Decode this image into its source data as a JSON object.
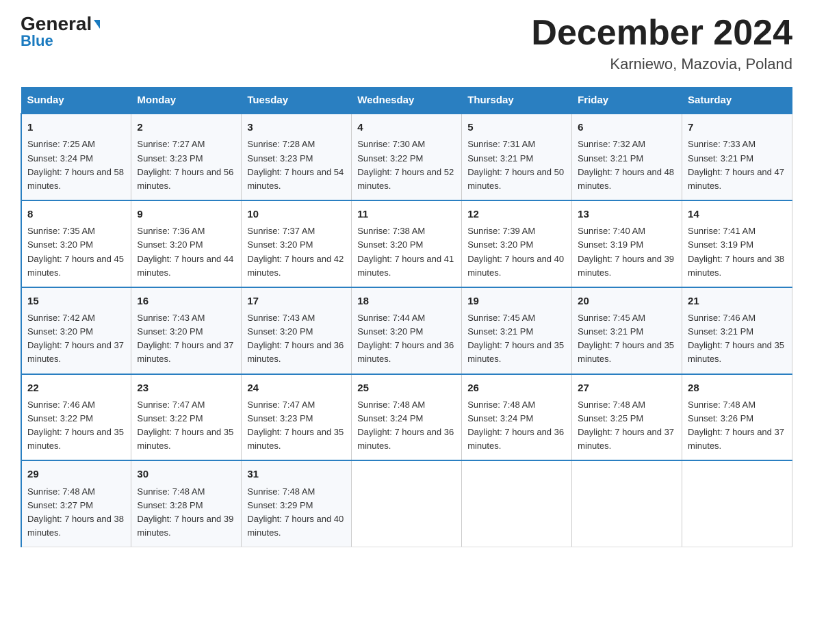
{
  "header": {
    "logo_main": "General",
    "logo_arrow": "▶",
    "logo_sub": "Blue",
    "month_title": "December 2024",
    "location": "Karniewo, Mazovia, Poland"
  },
  "weekdays": [
    "Sunday",
    "Monday",
    "Tuesday",
    "Wednesday",
    "Thursday",
    "Friday",
    "Saturday"
  ],
  "weeks": [
    [
      {
        "day": "1",
        "sunrise": "7:25 AM",
        "sunset": "3:24 PM",
        "daylight": "7 hours and 58 minutes."
      },
      {
        "day": "2",
        "sunrise": "7:27 AM",
        "sunset": "3:23 PM",
        "daylight": "7 hours and 56 minutes."
      },
      {
        "day": "3",
        "sunrise": "7:28 AM",
        "sunset": "3:23 PM",
        "daylight": "7 hours and 54 minutes."
      },
      {
        "day": "4",
        "sunrise": "7:30 AM",
        "sunset": "3:22 PM",
        "daylight": "7 hours and 52 minutes."
      },
      {
        "day": "5",
        "sunrise": "7:31 AM",
        "sunset": "3:21 PM",
        "daylight": "7 hours and 50 minutes."
      },
      {
        "day": "6",
        "sunrise": "7:32 AM",
        "sunset": "3:21 PM",
        "daylight": "7 hours and 48 minutes."
      },
      {
        "day": "7",
        "sunrise": "7:33 AM",
        "sunset": "3:21 PM",
        "daylight": "7 hours and 47 minutes."
      }
    ],
    [
      {
        "day": "8",
        "sunrise": "7:35 AM",
        "sunset": "3:20 PM",
        "daylight": "7 hours and 45 minutes."
      },
      {
        "day": "9",
        "sunrise": "7:36 AM",
        "sunset": "3:20 PM",
        "daylight": "7 hours and 44 minutes."
      },
      {
        "day": "10",
        "sunrise": "7:37 AM",
        "sunset": "3:20 PM",
        "daylight": "7 hours and 42 minutes."
      },
      {
        "day": "11",
        "sunrise": "7:38 AM",
        "sunset": "3:20 PM",
        "daylight": "7 hours and 41 minutes."
      },
      {
        "day": "12",
        "sunrise": "7:39 AM",
        "sunset": "3:20 PM",
        "daylight": "7 hours and 40 minutes."
      },
      {
        "day": "13",
        "sunrise": "7:40 AM",
        "sunset": "3:19 PM",
        "daylight": "7 hours and 39 minutes."
      },
      {
        "day": "14",
        "sunrise": "7:41 AM",
        "sunset": "3:19 PM",
        "daylight": "7 hours and 38 minutes."
      }
    ],
    [
      {
        "day": "15",
        "sunrise": "7:42 AM",
        "sunset": "3:20 PM",
        "daylight": "7 hours and 37 minutes."
      },
      {
        "day": "16",
        "sunrise": "7:43 AM",
        "sunset": "3:20 PM",
        "daylight": "7 hours and 37 minutes."
      },
      {
        "day": "17",
        "sunrise": "7:43 AM",
        "sunset": "3:20 PM",
        "daylight": "7 hours and 36 minutes."
      },
      {
        "day": "18",
        "sunrise": "7:44 AM",
        "sunset": "3:20 PM",
        "daylight": "7 hours and 36 minutes."
      },
      {
        "day": "19",
        "sunrise": "7:45 AM",
        "sunset": "3:21 PM",
        "daylight": "7 hours and 35 minutes."
      },
      {
        "day": "20",
        "sunrise": "7:45 AM",
        "sunset": "3:21 PM",
        "daylight": "7 hours and 35 minutes."
      },
      {
        "day": "21",
        "sunrise": "7:46 AM",
        "sunset": "3:21 PM",
        "daylight": "7 hours and 35 minutes."
      }
    ],
    [
      {
        "day": "22",
        "sunrise": "7:46 AM",
        "sunset": "3:22 PM",
        "daylight": "7 hours and 35 minutes."
      },
      {
        "day": "23",
        "sunrise": "7:47 AM",
        "sunset": "3:22 PM",
        "daylight": "7 hours and 35 minutes."
      },
      {
        "day": "24",
        "sunrise": "7:47 AM",
        "sunset": "3:23 PM",
        "daylight": "7 hours and 35 minutes."
      },
      {
        "day": "25",
        "sunrise": "7:48 AM",
        "sunset": "3:24 PM",
        "daylight": "7 hours and 36 minutes."
      },
      {
        "day": "26",
        "sunrise": "7:48 AM",
        "sunset": "3:24 PM",
        "daylight": "7 hours and 36 minutes."
      },
      {
        "day": "27",
        "sunrise": "7:48 AM",
        "sunset": "3:25 PM",
        "daylight": "7 hours and 37 minutes."
      },
      {
        "day": "28",
        "sunrise": "7:48 AM",
        "sunset": "3:26 PM",
        "daylight": "7 hours and 37 minutes."
      }
    ],
    [
      {
        "day": "29",
        "sunrise": "7:48 AM",
        "sunset": "3:27 PM",
        "daylight": "7 hours and 38 minutes."
      },
      {
        "day": "30",
        "sunrise": "7:48 AM",
        "sunset": "3:28 PM",
        "daylight": "7 hours and 39 minutes."
      },
      {
        "day": "31",
        "sunrise": "7:48 AM",
        "sunset": "3:29 PM",
        "daylight": "7 hours and 40 minutes."
      },
      null,
      null,
      null,
      null
    ]
  ],
  "labels": {
    "sunrise": "Sunrise:",
    "sunset": "Sunset:",
    "daylight": "Daylight:"
  }
}
